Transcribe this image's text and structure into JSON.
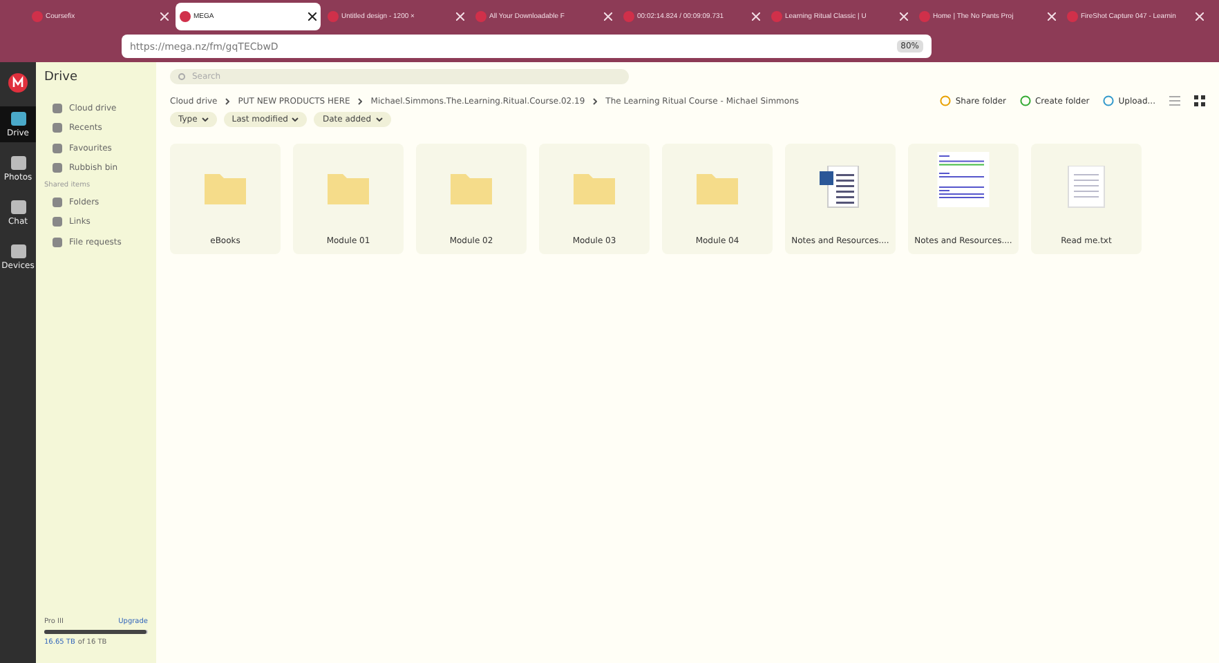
{
  "browser": {
    "tabs": [
      {
        "title": "Coursefix",
        "selected": false
      },
      {
        "title": "MEGA",
        "selected": true
      },
      {
        "title": "Untitled design - 1200 ×",
        "selected": false
      },
      {
        "title": "All Your Downloadable F",
        "selected": false
      },
      {
        "title": "00:02:14.824 / 00:09:09.731",
        "selected": false
      },
      {
        "title": "Learning Ritual Classic | U",
        "selected": false
      },
      {
        "title": "Home | The No Pants Proj",
        "selected": false
      },
      {
        "title": "FireShot Capture 047 - Learnin",
        "selected": false
      }
    ],
    "url": "https://mega.nz/fm/gqTECbwD",
    "zoom": "80%"
  },
  "rail": [
    {
      "label": "Drive",
      "selected": true
    },
    {
      "label": "Photos",
      "selected": false
    },
    {
      "label": "Chat",
      "selected": false
    },
    {
      "label": "Devices",
      "selected": false
    }
  ],
  "sidebar": {
    "title": "Drive",
    "items": [
      {
        "label": "Cloud drive"
      },
      {
        "label": "Recents"
      },
      {
        "label": "Favourites"
      },
      {
        "label": "Rubbish bin"
      }
    ],
    "shared_heading": "Shared items",
    "shared": [
      {
        "label": "Folders"
      },
      {
        "label": "Links"
      },
      {
        "label": "File requests"
      }
    ],
    "storage": {
      "plan": "Pro III",
      "upgrade": "Upgrade",
      "used": "16.65 TB",
      "total": "of 16 TB",
      "level": 0.98
    }
  },
  "search": {
    "placeholder": "Search"
  },
  "breadcrumbs": [
    "Cloud drive",
    "PUT NEW PRODUCTS HERE",
    "Michael.Simmons.The.Learning.Ritual.Course.02.19",
    "The Learning Ritual Course - Michael Simmons"
  ],
  "actions": [
    "Share folder",
    "Create folder",
    "Upload..."
  ],
  "filters": [
    "Type",
    "Last modified",
    "Date added"
  ],
  "files": [
    {
      "kind": "folder",
      "name": "eBooks"
    },
    {
      "kind": "folder",
      "name": "Module 01"
    },
    {
      "kind": "folder",
      "name": "Module 02"
    },
    {
      "kind": "folder",
      "name": "Module 03"
    },
    {
      "kind": "folder",
      "name": "Module 04"
    },
    {
      "kind": "word",
      "name": "Notes and Resources...."
    },
    {
      "kind": "preview",
      "name": "Notes and Resources...."
    },
    {
      "kind": "text",
      "name": "Read me.txt"
    }
  ]
}
